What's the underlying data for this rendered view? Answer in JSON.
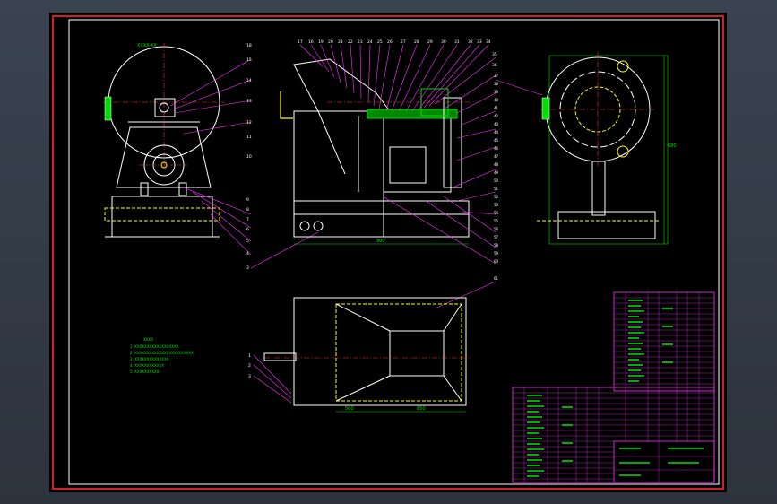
{
  "drawing": {
    "left_view_label": "XXXX-XX",
    "front_parts_top": [
      "17",
      "16",
      "19",
      "20",
      "21",
      "22",
      "23",
      "24",
      "25",
      "26",
      "27",
      "28",
      "29",
      "30",
      "31",
      "32",
      "33",
      "34",
      "35",
      "36"
    ],
    "front_parts_left": [
      "18",
      "15",
      "14",
      "13",
      "12",
      "11",
      "10",
      "9",
      "8",
      "7",
      "6",
      "5",
      "4",
      "3"
    ],
    "front_parts_right": [
      "37",
      "38",
      "39",
      "40",
      "41",
      "42",
      "43",
      "44",
      "45",
      "46",
      "47",
      "48",
      "49",
      "50",
      "51",
      "52",
      "53",
      "54",
      "55",
      "56",
      "57",
      "58",
      "59",
      "60",
      "61"
    ],
    "front_dimension": "900",
    "side_dimension": "680",
    "plan_dimension_a": "500",
    "plan_dimension_b": "850",
    "plan_parts": [
      "1",
      "2",
      "3"
    ]
  },
  "tech_notes": {
    "title": "XXXX",
    "lines": [
      "1. XXXXXXXXXXXXXXXXXX",
      "2. XXXXXXXXXXXXXXXXXXXXXXXX",
      "3. XXXXXXXXXXXXXX",
      "4. XXXXXXXXXXXX",
      "5. XXXXXXXXXX"
    ]
  },
  "colors": {
    "sheet": "#000000",
    "border": "#d22020",
    "geometry": "#ffffff",
    "leaders": "#ff33ff",
    "dims": "#00e000",
    "center": "#ff3030",
    "accent": "#ffff00"
  }
}
